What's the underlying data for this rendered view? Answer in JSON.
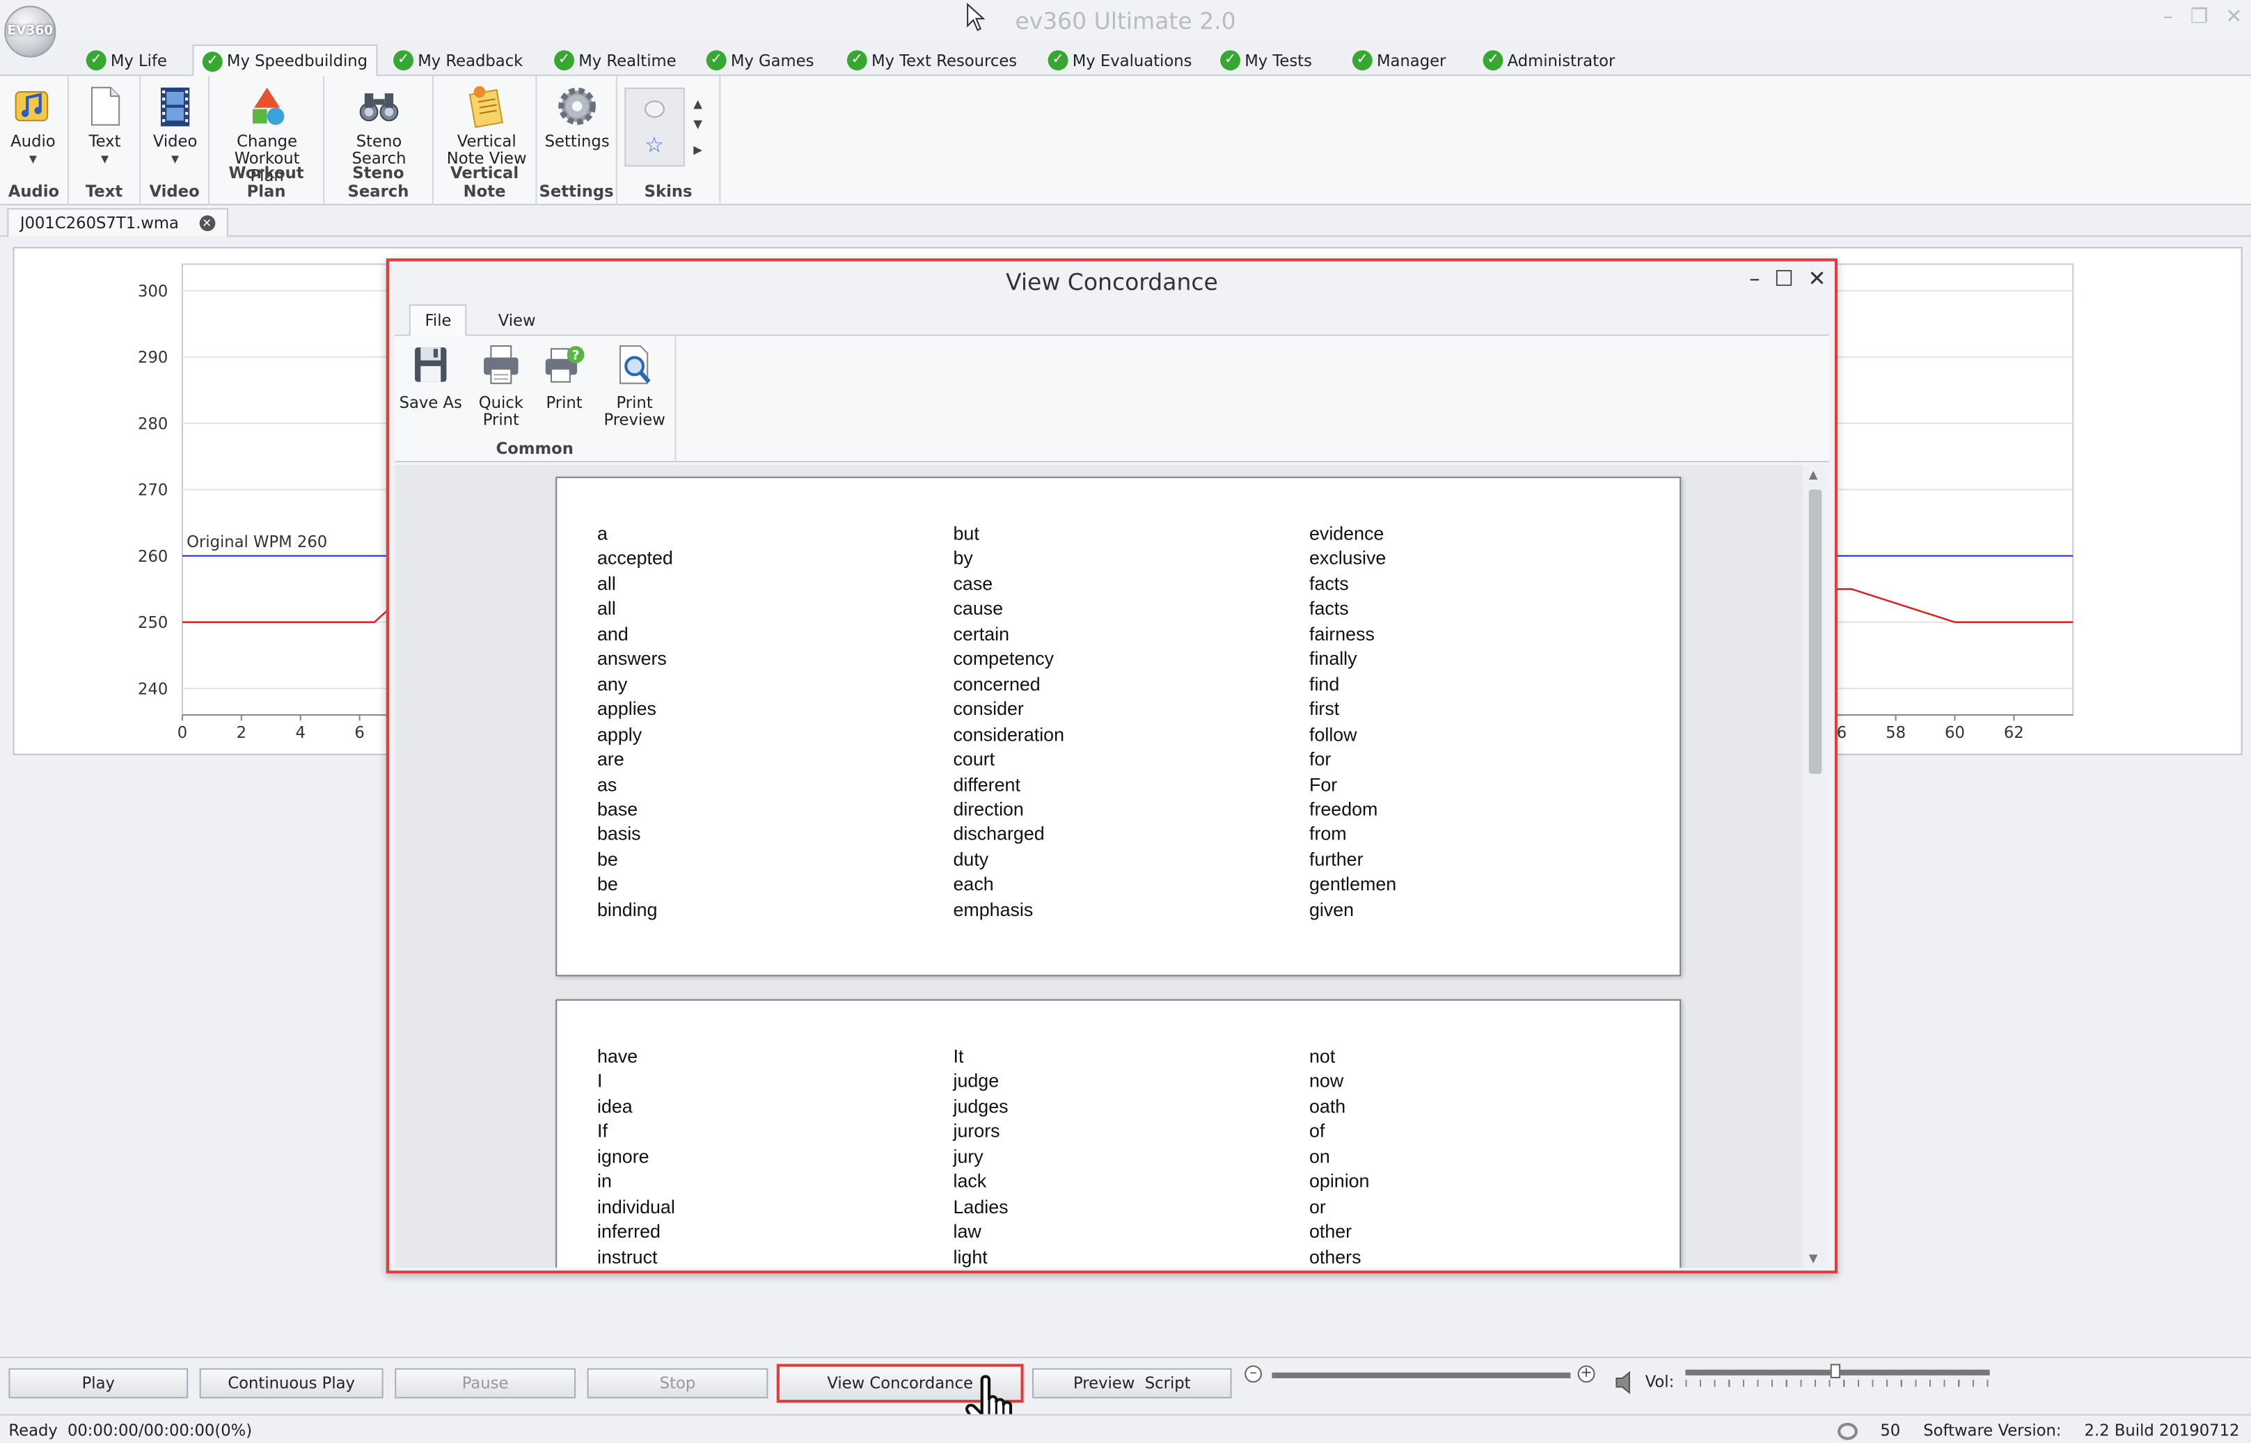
{
  "app": {
    "title": "ev360 Ultimate 2.0",
    "logo_text": "EV360"
  },
  "top_tabs": [
    {
      "label": "My Life"
    },
    {
      "label": "My Speedbuilding"
    },
    {
      "label": "My Readback"
    },
    {
      "label": "My Realtime"
    },
    {
      "label": "My Games"
    },
    {
      "label": "My Text Resources"
    },
    {
      "label": "My Evaluations"
    },
    {
      "label": "My Tests"
    },
    {
      "label": "Manager"
    },
    {
      "label": "Administrator"
    }
  ],
  "ribbon": {
    "audio": {
      "button": "Audio",
      "group": "Audio"
    },
    "text": {
      "button": "Text",
      "group": "Text"
    },
    "video": {
      "button": "Video",
      "group": "Video"
    },
    "workout": {
      "button_line1": "Change",
      "button_line2": "Workout Plan",
      "group": "Workout Plan"
    },
    "steno": {
      "button_line1": "Steno",
      "button_line2": "Search",
      "group": "Steno Search"
    },
    "vertical": {
      "button_line1": "Vertical",
      "button_line2": "Note View",
      "group": "Vertical Note"
    },
    "settings": {
      "button": "Settings",
      "group": "Settings"
    },
    "skins": {
      "group": "Skins"
    }
  },
  "document_tab": {
    "label": "J001C260S7T1.wma"
  },
  "chart_data": {
    "type": "line",
    "yticks": [
      300,
      290,
      280,
      270,
      260,
      250,
      240
    ],
    "ylim": [
      236,
      304
    ],
    "xticks_visible_left": [
      0,
      2,
      4,
      6
    ],
    "xticks_visible_right": [
      56,
      58,
      60,
      62
    ],
    "xlim": [
      0,
      64
    ],
    "reference_line": {
      "label": "Original WPM 260",
      "value": 260,
      "color": "#2a2adc"
    },
    "series": [
      {
        "color": "#e02020",
        "x": [
          0,
          6.5,
          7,
          56.5,
          60,
          64
        ],
        "values": [
          250,
          250,
          252,
          255,
          250,
          250
        ]
      }
    ]
  },
  "concordance": {
    "title": "View Concordance",
    "tabs": [
      {
        "label": "File"
      },
      {
        "label": "View"
      }
    ],
    "buttons": {
      "save_as": "Save As",
      "quick_print_1": "Quick",
      "quick_print_2": "Print",
      "print": "Print",
      "print_preview_1": "Print",
      "print_preview_2": "Preview"
    },
    "group_label": "Common",
    "page1": {
      "col1": [
        "a",
        "accepted",
        "all",
        "all",
        "and",
        "answers",
        "any",
        "applies",
        "apply",
        "are",
        "as",
        "base",
        "basis",
        "be",
        "be",
        "binding"
      ],
      "col2": [
        "but",
        "by",
        "case",
        "cause",
        "certain",
        "competency",
        "concerned",
        "consider",
        "consideration",
        "court",
        "different",
        "direction",
        "discharged",
        "duty",
        "each",
        "emphasis"
      ],
      "col3": [
        "evidence",
        "exclusive",
        "facts",
        "facts",
        "fairness",
        "finally",
        "find",
        "first",
        "follow",
        "for",
        "For",
        "freedom",
        "from",
        "further",
        "gentlemen",
        "given"
      ]
    },
    "page2": {
      "col1": [
        "have",
        "I",
        "idea",
        "If",
        "ignore",
        "in",
        "individual",
        "inferred",
        "instruct"
      ],
      "col2": [
        "It",
        "judge",
        "judges",
        "jurors",
        "jury",
        "lack",
        "Ladies",
        "law",
        "light"
      ],
      "col3": [
        "not",
        "now",
        "oath",
        "of",
        "on",
        "opinion",
        "or",
        "other",
        "others"
      ]
    }
  },
  "controls": {
    "play": "Play",
    "continuous_play": "Continuous Play",
    "pause": "Pause",
    "stop": "Stop",
    "view_concordance": "View Concordance",
    "preview_script": "Preview  Script",
    "vol_label": "Vol:"
  },
  "status": {
    "state": "Ready",
    "time": "00:00:00/00:00:00(0%)",
    "count": "50",
    "version_label": "Software Version:",
    "version": "2.2 Build 20190712"
  }
}
